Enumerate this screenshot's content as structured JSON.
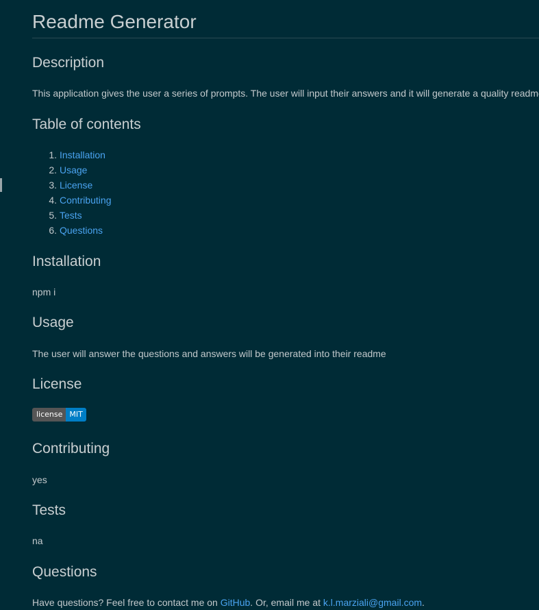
{
  "title": "Readme Generator",
  "description": {
    "heading": "Description",
    "text": "This application gives the user a series of prompts. The user will input their answers and it will generate a quality readme."
  },
  "toc": {
    "heading": "Table of contents",
    "items": [
      {
        "num": "1.",
        "label": "Installation"
      },
      {
        "num": "2.",
        "label": "Usage"
      },
      {
        "num": "3.",
        "label": "License"
      },
      {
        "num": "4.",
        "label": "Contributing"
      },
      {
        "num": "5.",
        "label": "Tests"
      },
      {
        "num": "6.",
        "label": "Questions"
      }
    ]
  },
  "installation": {
    "heading": "Installation",
    "text": "npm i"
  },
  "usage": {
    "heading": "Usage",
    "text": "The user will answer the questions and answers will be generated into their readme"
  },
  "license": {
    "heading": "License",
    "badge_label": "license",
    "badge_value": "MIT",
    "badge_label_color": "#555555",
    "badge_value_color": "#007ec6"
  },
  "contributing": {
    "heading": "Contributing",
    "text": "yes"
  },
  "tests": {
    "heading": "Tests",
    "text": "na"
  },
  "questions": {
    "heading": "Questions",
    "text_before": "Have questions? Feel free to contact me on ",
    "github_link": "GitHub",
    "text_middle": ". Or, email me at ",
    "email_link": "k.l.marziali@gmail.com",
    "text_after": "."
  },
  "colors": {
    "background": "#002b36",
    "link": "#4aa3f0",
    "text": "#c3c9cc"
  }
}
